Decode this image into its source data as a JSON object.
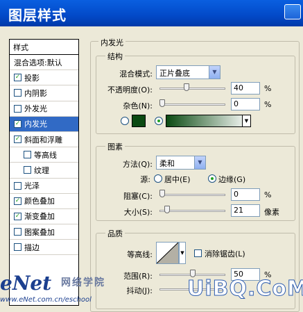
{
  "window": {
    "title": "图层样式"
  },
  "left_panel": {
    "header": "样式",
    "items": [
      {
        "label": "混合选项:默认",
        "checkbox": false,
        "checked": false,
        "selected": false,
        "sub": false
      },
      {
        "label": "投影",
        "checkbox": true,
        "checked": true,
        "selected": false,
        "sub": false
      },
      {
        "label": "内阴影",
        "checkbox": true,
        "checked": false,
        "selected": false,
        "sub": false
      },
      {
        "label": "外发光",
        "checkbox": true,
        "checked": false,
        "selected": false,
        "sub": false
      },
      {
        "label": "内发光",
        "checkbox": true,
        "checked": true,
        "selected": true,
        "sub": false
      },
      {
        "label": "斜面和浮雕",
        "checkbox": true,
        "checked": true,
        "selected": false,
        "sub": false
      },
      {
        "label": "等高线",
        "checkbox": true,
        "checked": false,
        "selected": false,
        "sub": true
      },
      {
        "label": "纹理",
        "checkbox": true,
        "checked": false,
        "selected": false,
        "sub": true
      },
      {
        "label": "光泽",
        "checkbox": true,
        "checked": false,
        "selected": false,
        "sub": false
      },
      {
        "label": "颜色叠加",
        "checkbox": true,
        "checked": true,
        "selected": false,
        "sub": false
      },
      {
        "label": "渐变叠加",
        "checkbox": true,
        "checked": true,
        "selected": false,
        "sub": false
      },
      {
        "label": "图案叠加",
        "checkbox": true,
        "checked": false,
        "selected": false,
        "sub": false
      },
      {
        "label": "描边",
        "checkbox": true,
        "checked": false,
        "selected": false,
        "sub": false
      }
    ]
  },
  "inner_glow": {
    "title": "内发光",
    "structure": {
      "title": "结构",
      "blend_mode_label": "混合模式:",
      "blend_mode_value": "正片叠底",
      "opacity_label": "不透明度(O):",
      "opacity_value": "40",
      "opacity_unit": "%",
      "opacity_level": 0.4,
      "noise_label": "杂色(N):",
      "noise_value": "0",
      "noise_unit": "%",
      "noise_level": 0,
      "color_swatch": "#0b4a12",
      "gradient_from": "#0b4a12",
      "gradient_to": "#ffffff"
    },
    "elements": {
      "title": "图素",
      "method_label": "方法(Q):",
      "method_value": "柔和",
      "source_label": "源:",
      "source_center": "居中(E)",
      "source_edge": "边缘(G)",
      "choke_label": "阻塞(C):",
      "choke_value": "0",
      "choke_unit": "%",
      "choke_level": 0,
      "size_label": "大小(S):",
      "size_value": "21",
      "size_unit": "像素",
      "size_level": 0.084
    },
    "quality": {
      "title": "品质",
      "contour_label": "等高线:",
      "antialias_label": "消除锯齿(L)",
      "range_label": "范围(R):",
      "range_value": "50",
      "range_unit": "%",
      "range_level": 0.5,
      "jitter_label": "抖动(J):"
    }
  },
  "watermarks": {
    "left_logo": "eNet",
    "left_cn": "网络学院",
    "left_url": "www.eNet.com.cn/eschool",
    "right_logo": "UiBQ.CoM"
  },
  "colors": {
    "title_bar": "#0249c8",
    "selection": "#316ac5",
    "check": "#21a121"
  }
}
